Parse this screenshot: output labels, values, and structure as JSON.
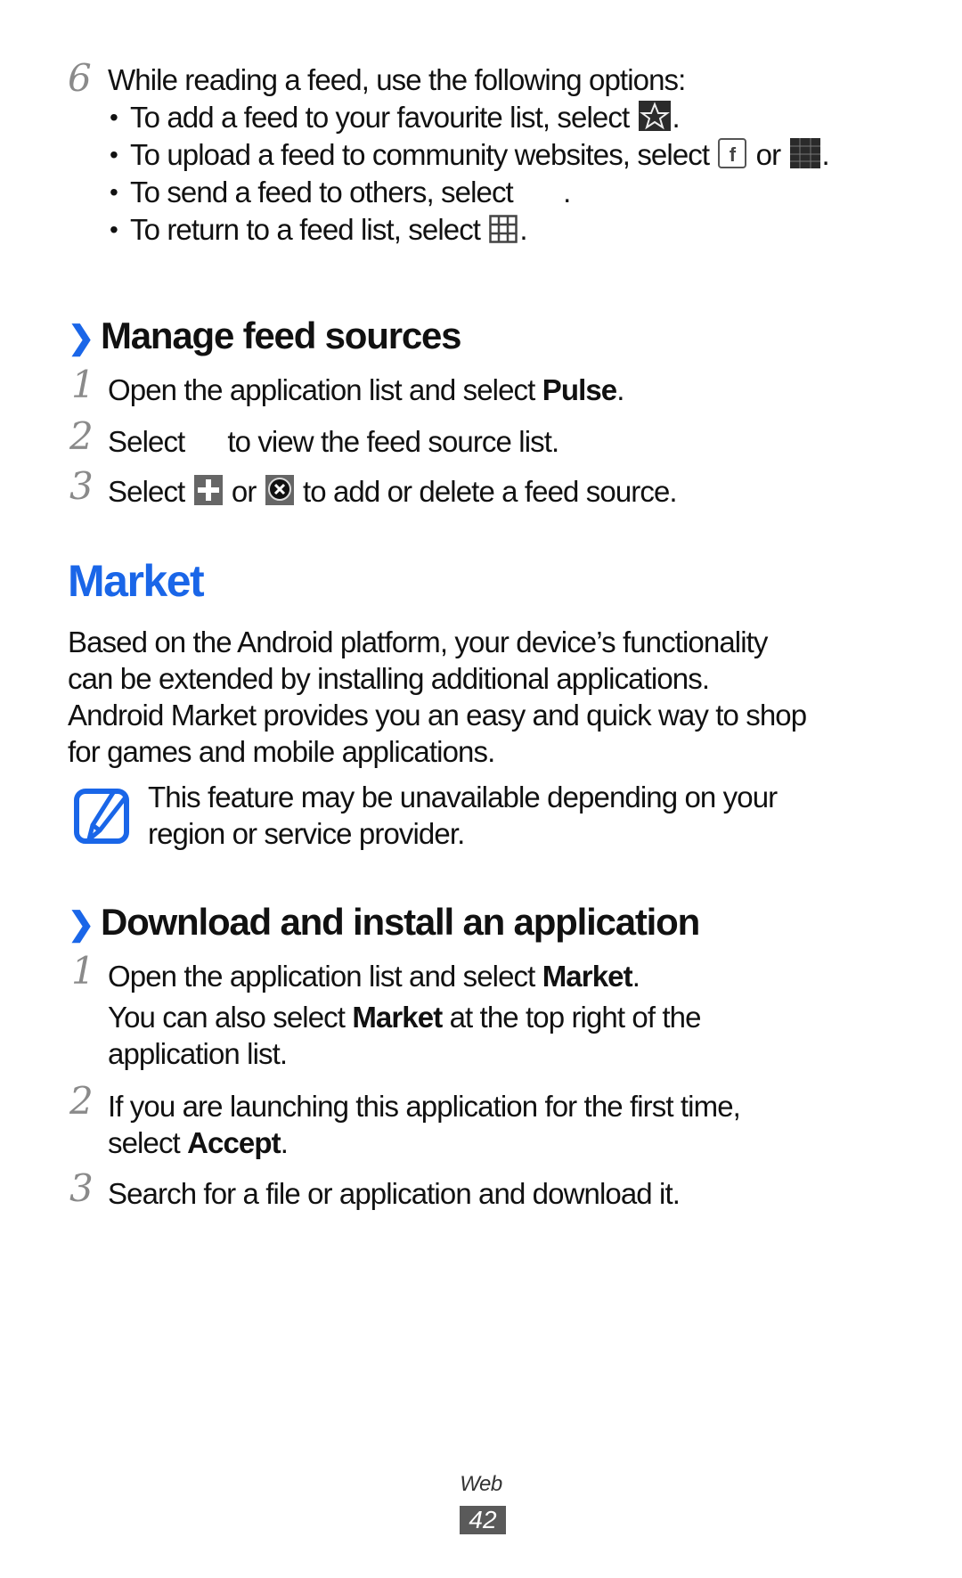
{
  "step6": {
    "number": "6",
    "intro": "While reading a feed, use the following options:",
    "bullets": [
      {
        "text_before": "To add a feed to your favourite list, select ",
        "icons": [
          "star-icon"
        ],
        "text_after": "."
      },
      {
        "text_before": "To upload a feed to community websites, select ",
        "middle": " or ",
        "icons": [
          "facebook-icon",
          "social-network-icon"
        ],
        "text_after": "."
      },
      {
        "text_before": "To send a feed to others, select ",
        "icons": [],
        "text_after": "."
      },
      {
        "text_before": "To return to a feed list, select ",
        "icons": [
          "grid-icon"
        ],
        "text_after": "."
      }
    ]
  },
  "manage_section": {
    "chevron": "❯",
    "title": "Manage feed sources",
    "steps": [
      {
        "number": "1",
        "text_before": "Open the application list and select ",
        "bold": "Pulse",
        "text_after": "."
      },
      {
        "number": "2",
        "text_before": "Select",
        "text_after": "to view the feed source list."
      },
      {
        "number": "3",
        "text_before": "Select ",
        "middle": " or ",
        "text_after": " to add or delete a feed source."
      }
    ]
  },
  "market": {
    "title": "Market",
    "paragraph_lines": [
      "Based on the Android platform, your device’s functionality",
      "can be extended by installing additional applications.",
      "Android Market provides you an easy and quick way to shop",
      "for games and mobile applications."
    ],
    "note_lines": [
      "This feature may be unavailable depending on your",
      "region or service provider."
    ]
  },
  "download_section": {
    "chevron": "❯",
    "title": "Download and install an application",
    "steps": [
      {
        "number": "1",
        "text_before": "Open the application list and select ",
        "bold": "Market",
        "text_after": ".",
        "sub_before": "You can also select ",
        "sub_bold": "Market",
        "sub_after": " at the top right of the",
        "sub_line2": "application list."
      },
      {
        "number": "2",
        "line1": "If you are launching this application for the first time,",
        "line2_before": "select ",
        "line2_bold": "Accept",
        "line2_after": "."
      },
      {
        "number": "3",
        "text": "Search for a file or application and download it."
      }
    ]
  },
  "footer": {
    "section": "Web",
    "page": "42"
  },
  "colors": {
    "accent": "#1a66e8",
    "page_badge": "#5a5a5a",
    "step_number": "#8a8a8a"
  }
}
